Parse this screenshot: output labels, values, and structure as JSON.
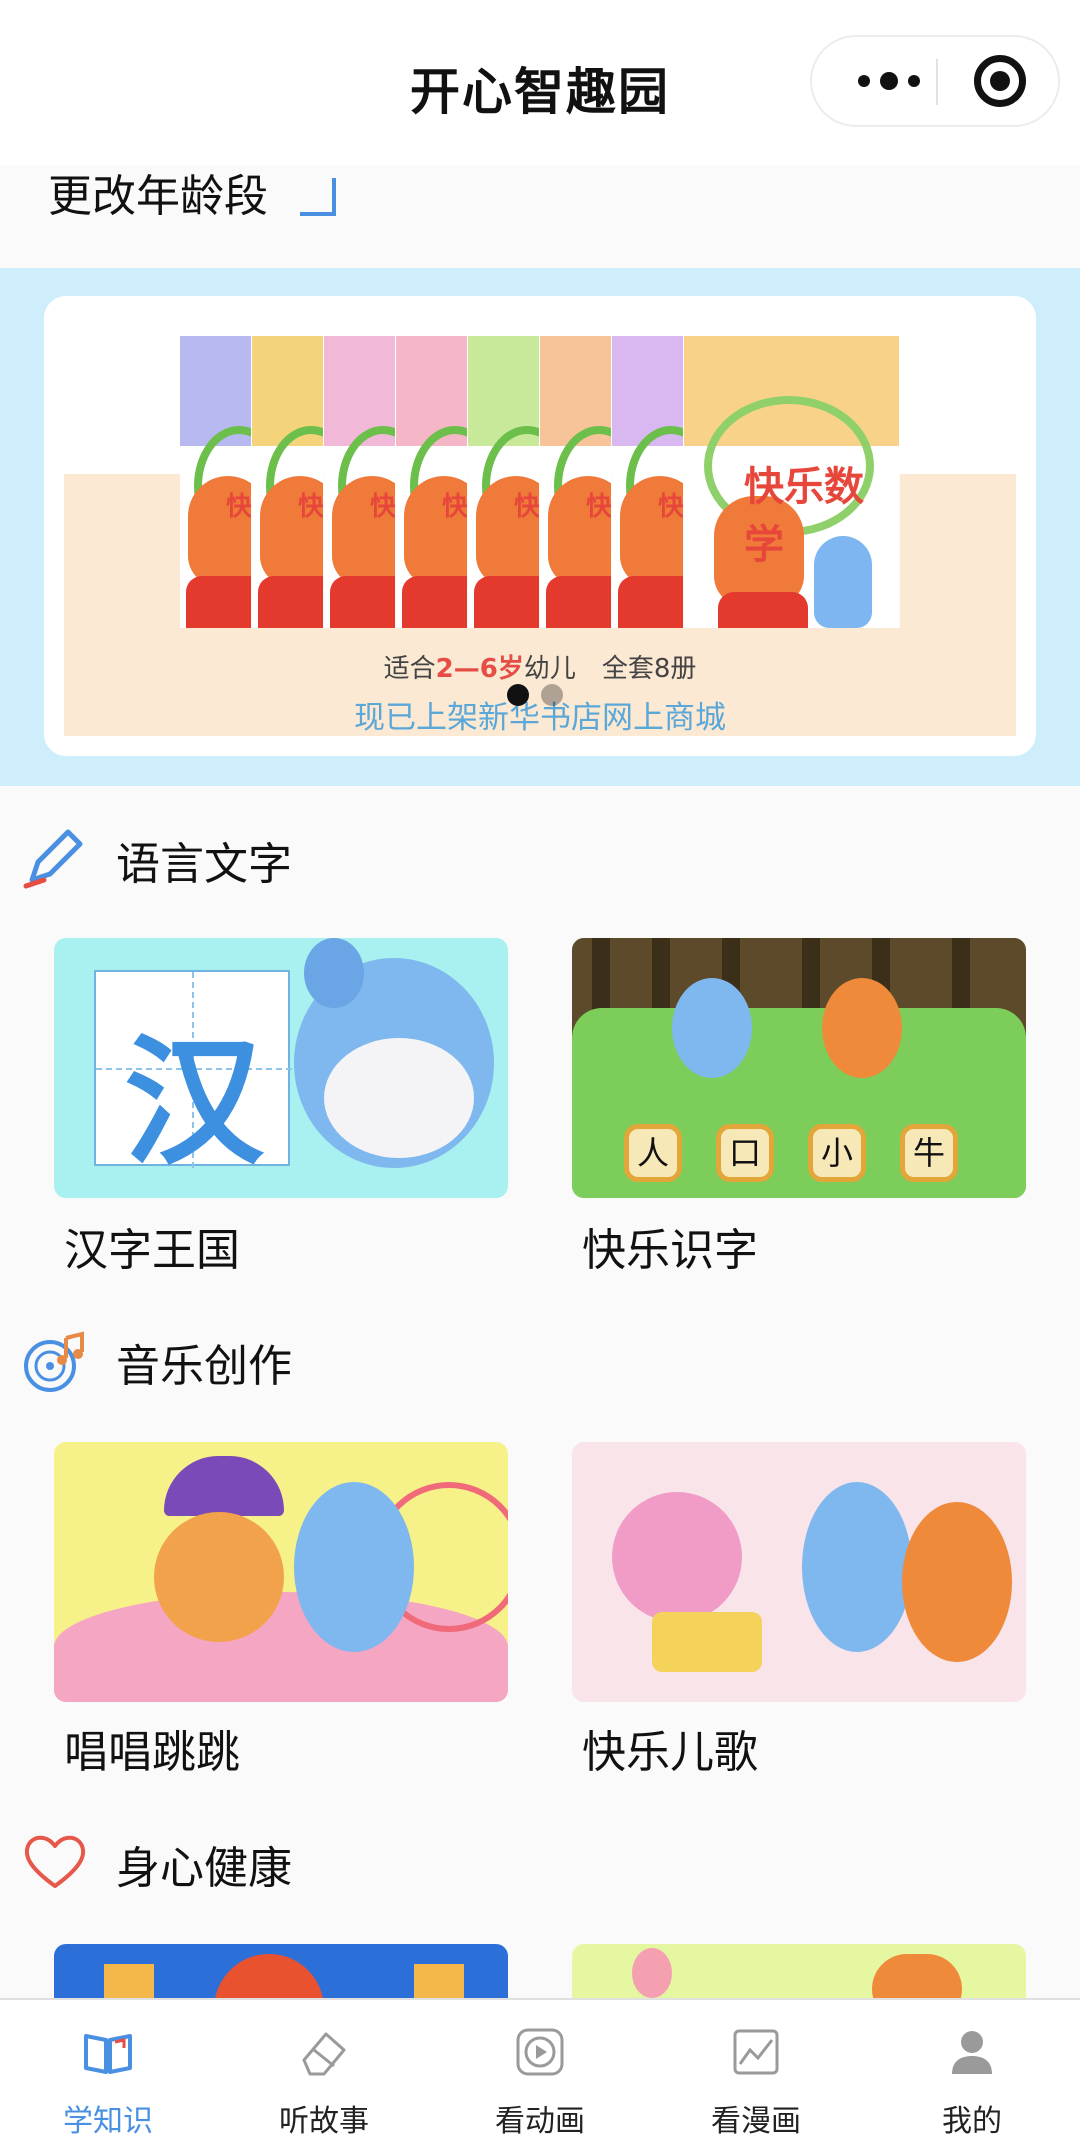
{
  "header": {
    "title": "开心智趣园"
  },
  "age": {
    "label": "更改年龄段"
  },
  "banner": {
    "subtitle_prefix": "适合",
    "subtitle_highlight": "2—6岁",
    "subtitle_suffix": "幼儿　全套8册",
    "line2": "现已上架新华书店网上商城",
    "book_word": "快",
    "big_book_word": "快乐数学",
    "active_dot": 1,
    "dot_count": 2
  },
  "sections": [
    {
      "title": "语言文字",
      "icon": "pencil-icon",
      "items": [
        {
          "label": "汉字王国",
          "art_char": "汉"
        },
        {
          "label": "快乐识字",
          "tiles": [
            "人",
            "口",
            "小",
            "牛"
          ]
        }
      ]
    },
    {
      "title": "音乐创作",
      "icon": "music-disc-icon",
      "items": [
        {
          "label": "唱唱跳跳"
        },
        {
          "label": "快乐儿歌"
        }
      ]
    },
    {
      "title": "身心健康",
      "icon": "heart-icon",
      "items": []
    }
  ],
  "tabs": [
    {
      "label": "学知识",
      "icon": "book-icon",
      "active": true
    },
    {
      "label": "听故事",
      "icon": "eraser-icon",
      "active": false
    },
    {
      "label": "看动画",
      "icon": "video-play-icon",
      "active": false
    },
    {
      "label": "看漫画",
      "icon": "picture-icon",
      "active": false
    },
    {
      "label": "我的",
      "icon": "user-icon",
      "active": false
    }
  ],
  "colors": {
    "accent": "#4a90e2",
    "banner_bg": "#cfeefc",
    "highlight": "#e64e45"
  }
}
